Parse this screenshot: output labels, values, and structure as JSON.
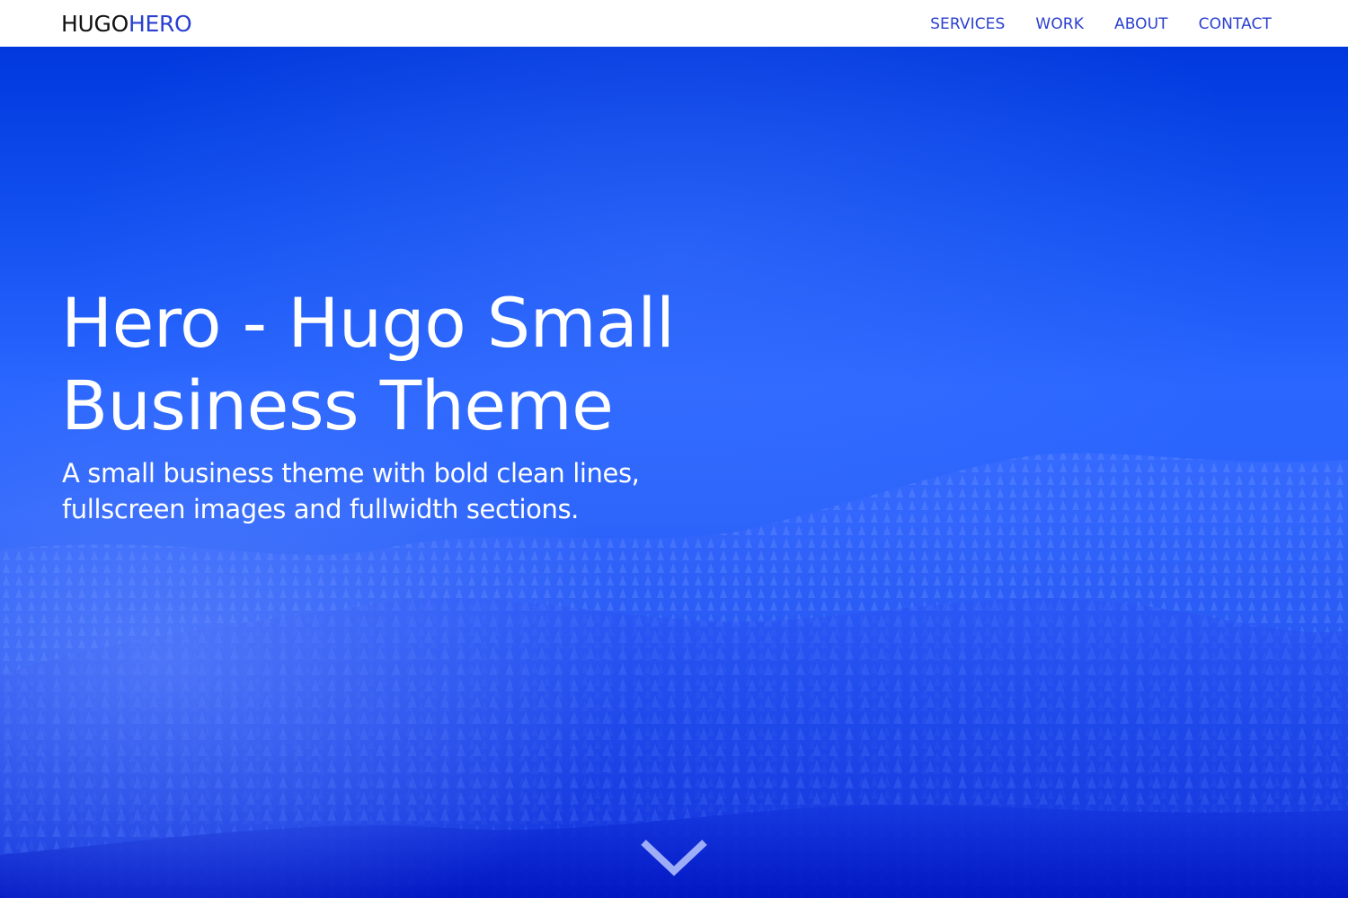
{
  "brand": {
    "part1": "HUGO",
    "part2": "HERO",
    "color_part1": "#111111",
    "color_part2": "#2a3fcf"
  },
  "nav": {
    "items": [
      {
        "label": "SERVICES"
      },
      {
        "label": "WORK"
      },
      {
        "label": "ABOUT"
      },
      {
        "label": "CONTACT"
      }
    ],
    "link_color": "#2a3fcf"
  },
  "hero": {
    "title": "Hero - Hugo Small Business Theme",
    "subtitle": "A small business theme with bold clean lines, fullscreen images and fullwidth sections.",
    "overlay_color": "#1a4fff",
    "scroll_icon": "chevron-down-icon"
  }
}
